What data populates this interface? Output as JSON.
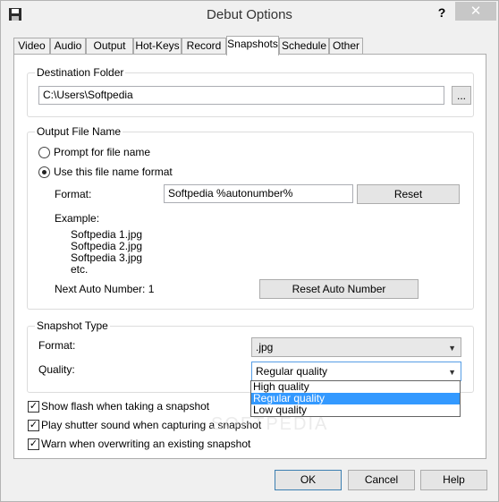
{
  "window": {
    "title": "Debut Options",
    "help": "?",
    "close": "✕"
  },
  "tabs": [
    "Video",
    "Audio",
    "Output",
    "Hot-Keys",
    "Record",
    "Snapshots",
    "Schedule",
    "Other"
  ],
  "active_tab": "Snapshots",
  "destination": {
    "legend": "Destination Folder",
    "path": "C:\\Users\\Softpedia",
    "browse_label": "..."
  },
  "output_name": {
    "legend": "Output File Name",
    "prompt_label": "Prompt for file name",
    "use_format_label": "Use this file name format",
    "format_label": "Format:",
    "format_value": "Softpedia %autonumber%",
    "reset_label": "Reset",
    "example_label": "Example:",
    "examples": [
      "Softpedia 1.jpg",
      "Softpedia 2.jpg",
      "Softpedia 3.jpg",
      "etc."
    ],
    "next_auto_label": "Next Auto Number: 1",
    "reset_auto_label": "Reset Auto Number"
  },
  "snapshot_type": {
    "legend": "Snapshot Type",
    "format_label": "Format:",
    "format_value": ".jpg",
    "quality_label": "Quality:",
    "quality_value": "Regular quality",
    "quality_options": [
      "High quality",
      "Regular quality",
      "Low quality"
    ]
  },
  "checks": [
    {
      "label": "Show flash when taking a snapshot",
      "checked": true
    },
    {
      "label": "Play shutter sound when capturing a snapshot",
      "checked": true
    },
    {
      "label": "Warn when overwriting an existing snapshot",
      "checked": true
    }
  ],
  "buttons": {
    "ok": "OK",
    "cancel": "Cancel",
    "help": "Help"
  },
  "watermark": "SOFTPEDIA"
}
